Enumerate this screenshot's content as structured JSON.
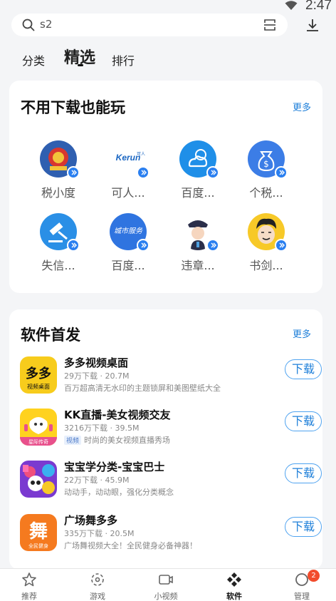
{
  "status_bar": {
    "time": "2:47"
  },
  "search": {
    "value": "s2"
  },
  "top_tabs": [
    {
      "label": "分类"
    },
    {
      "label": "精选"
    },
    {
      "label": "排行"
    }
  ],
  "section_games": {
    "title": "不用下载也能玩",
    "more": "更多",
    "items": [
      {
        "name": "税小度",
        "icon": "tax-emblem-icon"
      },
      {
        "name": "可人...",
        "icon": "kerun-logo-icon"
      },
      {
        "name": "百度...",
        "icon": "weather-icon"
      },
      {
        "name": "个税...",
        "icon": "money-bag-icon"
      },
      {
        "name": "失信...",
        "icon": "gavel-icon"
      },
      {
        "name": "百度...",
        "icon": "city-service-icon"
      },
      {
        "name": "违章...",
        "icon": "traffic-police-icon"
      },
      {
        "name": "书剑...",
        "icon": "cartoon-face-icon"
      }
    ],
    "kerun_logo_text": "Kerun",
    "kerun_logo_sub": "可人",
    "city_logo_text": "城市服务"
  },
  "section_apps": {
    "title": "软件首发",
    "more": "更多",
    "items": [
      {
        "name": "多多视频桌面",
        "meta": "29万下载 · 20.7M",
        "tag": "",
        "desc": "百万超高清无水印的主题锁屏和美图壁纸大全",
        "button": "下载",
        "icon_text_big": "多多",
        "icon_text_small": "视频桌面"
      },
      {
        "name": "KK直播-美女视频交友",
        "meta": "3216万下载 · 39.5M",
        "tag": "视频",
        "desc": "时尚的美女视频直播秀场",
        "button": "下载",
        "icon_text_small": "星际传奇"
      },
      {
        "name": "宝宝学分类-宝宝巴士",
        "meta": "22万下载 · 45.9M",
        "tag": "",
        "desc": "动动手，动动眼，强化分类概念",
        "button": "下载"
      },
      {
        "name": "广场舞多多",
        "meta": "335万下载 · 20.5M",
        "tag": "",
        "desc": "广场舞视频大全！全民健身必备神器！",
        "button": "下载",
        "icon_text_big": "舞",
        "icon_text_small": "全民健身"
      }
    ]
  },
  "bottom_nav": [
    {
      "label": "推荐",
      "icon": "star-icon"
    },
    {
      "label": "游戏",
      "icon": "gamepad-icon"
    },
    {
      "label": "小视频",
      "icon": "video-icon"
    },
    {
      "label": "软件",
      "icon": "software-diamond-icon",
      "active": true
    },
    {
      "label": "管理",
      "icon": "manage-icon",
      "badge": "2"
    }
  ],
  "colors": {
    "accent": "#1e7fd9",
    "badge_red": "#f24c2c",
    "background": "#f4f5f7"
  }
}
